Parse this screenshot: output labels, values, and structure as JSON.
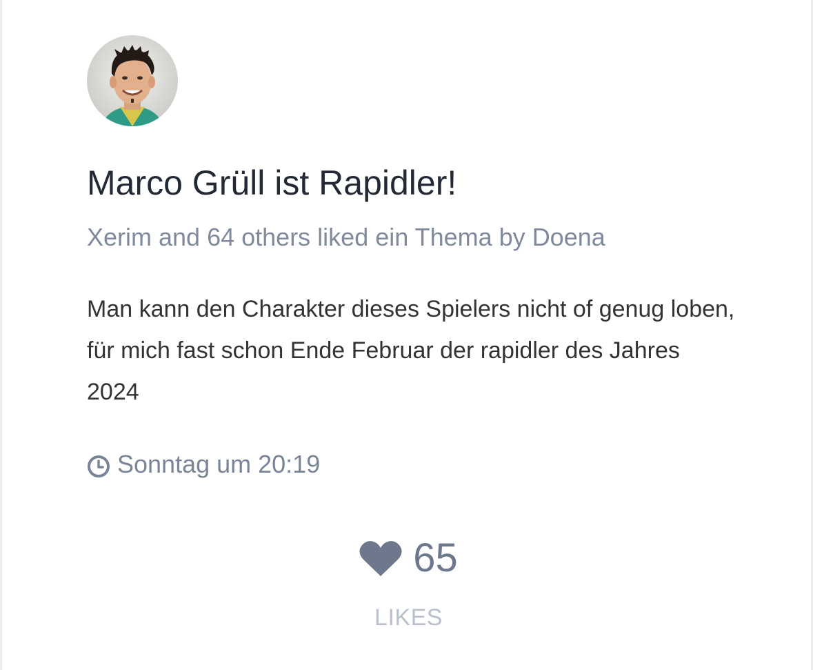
{
  "post": {
    "avatar": "avatar",
    "title": "Marco Grüll ist Rapidler!",
    "liked_by": "Xerim",
    "liked_by_rest": " and 64 others liked ein Thema by ",
    "author": "Doena",
    "body": "Man kann den Charakter dieses Spielers nicht of genug loben, für mich fast schon Ende Februar der rapidler des Jahres 2024",
    "timestamp": "Sonntag um 20:19",
    "timestamp_icon": "clock-icon"
  },
  "likes": {
    "icon": "heart-icon",
    "count": "65",
    "label": "LIKES"
  },
  "colors": {
    "title": "#232935",
    "muted": "#808a9c",
    "body": "#333333",
    "icon": "#6d788c",
    "likes_label": "#b9c0cc"
  }
}
